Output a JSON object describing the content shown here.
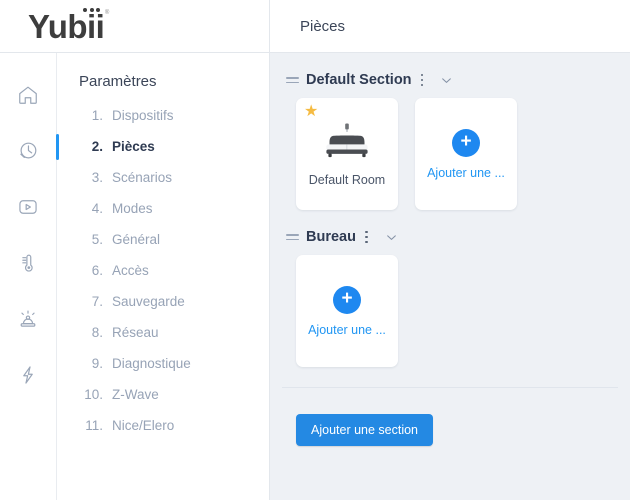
{
  "brand": {
    "name": "Yubii",
    "registered_mark": "®",
    "dots": 3
  },
  "header": {
    "page_title": "Pièces"
  },
  "rail": {
    "items": [
      {
        "name": "home-icon",
        "label": "Accueil"
      },
      {
        "name": "history-icon",
        "label": "Historique"
      },
      {
        "name": "play-icon",
        "label": "Scènes"
      },
      {
        "name": "thermometer-icon",
        "label": "Climat"
      },
      {
        "name": "siren-icon",
        "label": "Alarme"
      },
      {
        "name": "bolt-icon",
        "label": "Consommation"
      }
    ]
  },
  "settings": {
    "title": "Paramètres",
    "items": [
      {
        "num": "1.",
        "label": "Dispositifs",
        "active": false
      },
      {
        "num": "2.",
        "label": "Pièces",
        "active": true
      },
      {
        "num": "3.",
        "label": "Scénarios",
        "active": false
      },
      {
        "num": "4.",
        "label": "Modes",
        "active": false
      },
      {
        "num": "5.",
        "label": "Général",
        "active": false
      },
      {
        "num": "6.",
        "label": "Accès",
        "active": false
      },
      {
        "num": "7.",
        "label": "Sauvegarde",
        "active": false
      },
      {
        "num": "8.",
        "label": "Réseau",
        "active": false
      },
      {
        "num": "9.",
        "label": "Diagnostique",
        "active": false
      },
      {
        "num": "10.",
        "label": "Z-Wave",
        "active": false
      },
      {
        "num": "11.",
        "label": "Nice/Elero",
        "active": false
      }
    ]
  },
  "main": {
    "sections": [
      {
        "name": "Default Section",
        "cards": [
          {
            "type": "room",
            "label": "Default Room",
            "icon": "bed-icon",
            "favorite": true
          },
          {
            "type": "add",
            "label": "Ajouter une ..."
          }
        ]
      },
      {
        "name": "Bureau",
        "cards": [
          {
            "type": "add",
            "label": "Ajouter une ..."
          }
        ]
      }
    ],
    "add_section_button": "Ajouter une section"
  },
  "colors": {
    "accent_blue": "#2196f3",
    "button_blue": "#2489e3",
    "plus_blue": "#1e88f0",
    "content_bg": "#eef1f5",
    "star_gold": "#f5bb42",
    "text_dark": "#2f3b52",
    "text_muted": "#97a3b6"
  }
}
